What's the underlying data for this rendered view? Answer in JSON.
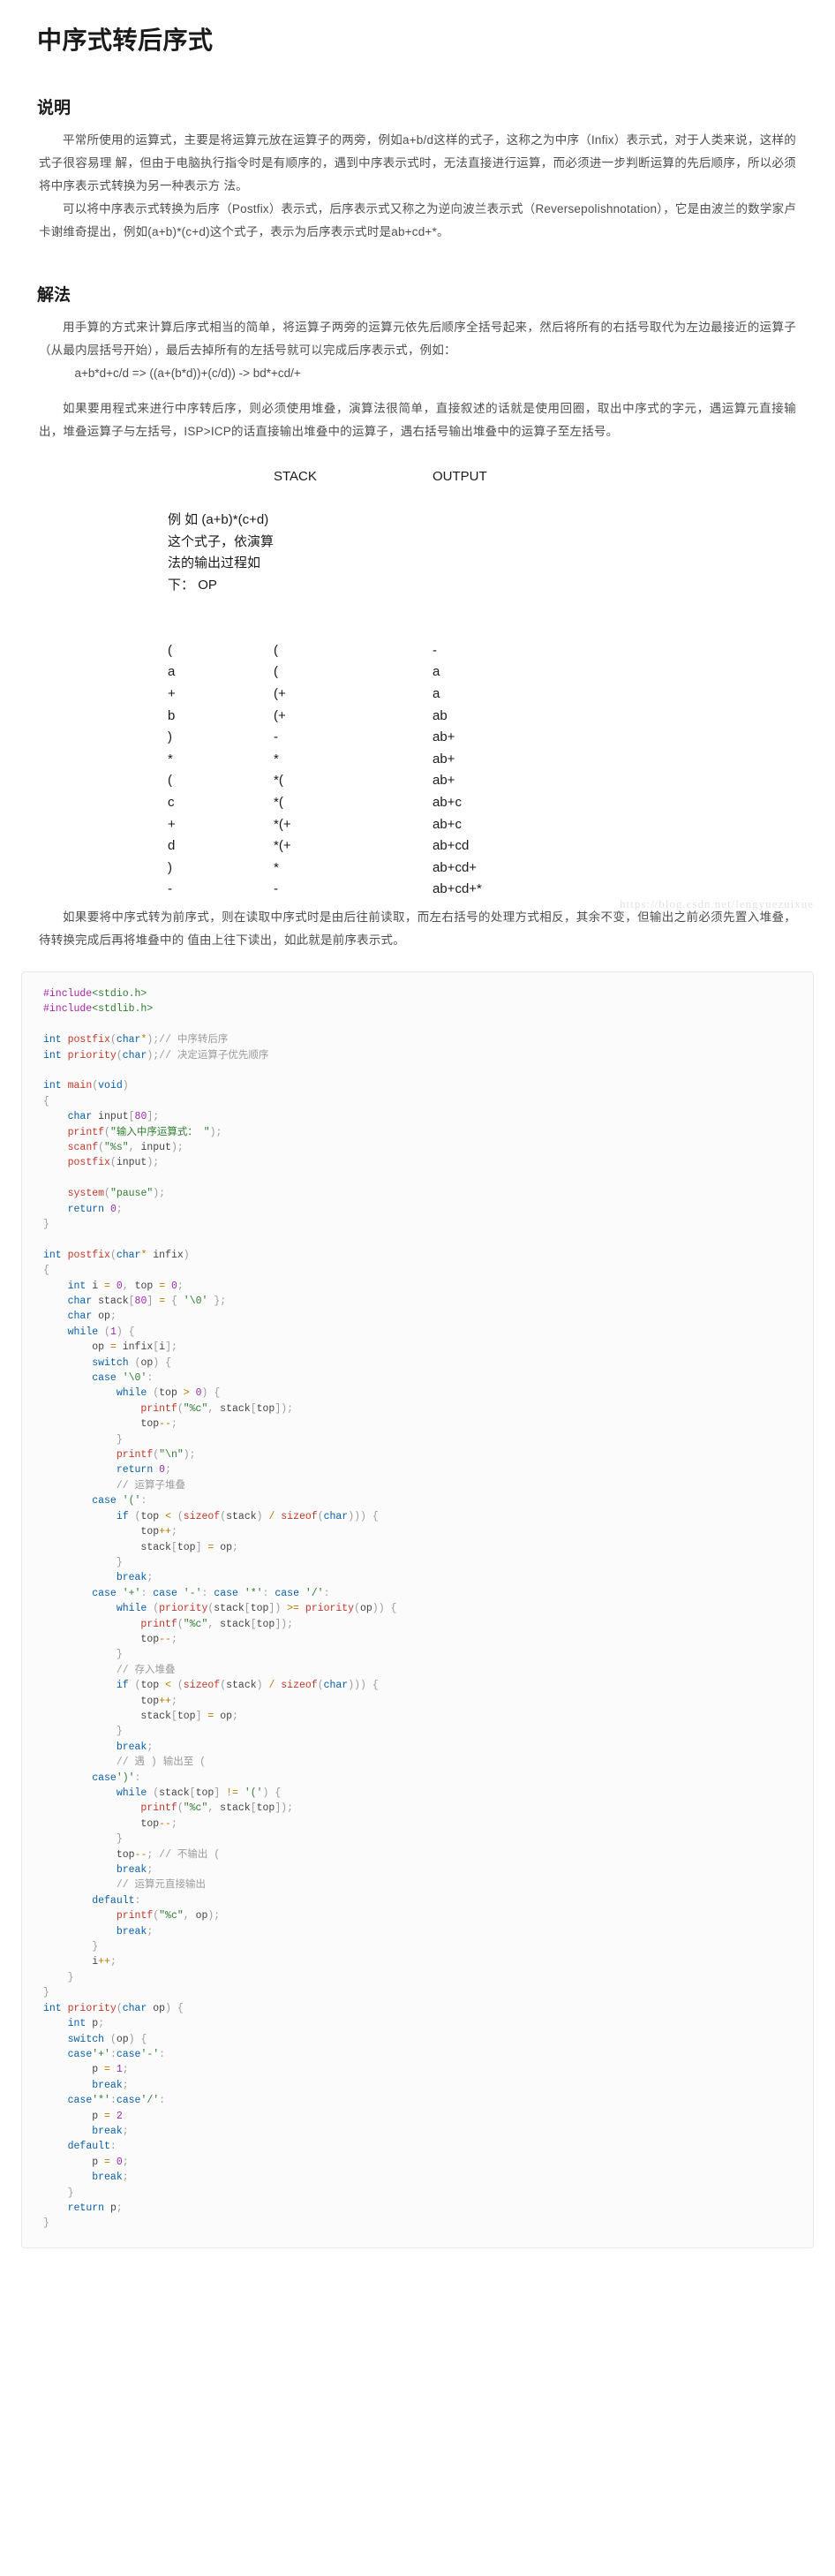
{
  "article": {
    "title": "中序式转后序式",
    "watermark": "https://blog.csdn.net/lengyuezuixue"
  },
  "sections": [
    {
      "heading": "说明"
    },
    {
      "heading": "解法"
    }
  ],
  "explain": {
    "heading": "说明",
    "p1": "平常所使用的运算式，主要是将运算元放在运算子的两旁，例如a+b/d这样的式子，这称之为中序（Infix）表示式，对于人类来说，这样的式子很容易理 解，但由于电脑执行指令时是有顺序的，遇到中序表示式时，无法直接进行运算，而必须进一步判断运算的先后顺序，所以必须将中序表示式转换为另一种表示方 法。",
    "p2": "可以将中序表示式转换为后序（Postfix）表示式，后序表示式又称之为逆向波兰表示式（Reversepolishnotation），它是由波兰的数学家卢卡谢维奇提出，例如(a+b)*(c+d)这个式子，表示为后序表示式时是ab+cd+*。"
  },
  "solution": {
    "heading": "解法",
    "p1": "用手算的方式来计算后序式相当的简单，将运算子两旁的运算元依先后顺序全括号起来，然后将所有的右括号取代为左边最接近的运算子（从最内层括号开始），最后去掉所有的左括号就可以完成后序表示式，例如：",
    "example": "a+b*d+c/d => ((a+(b*d))+(c/d)) -> bd*+cd/+",
    "p2": "如果要用程式来进行中序转后序，则必须使用堆叠，演算法很简单，直接叙述的话就是使用回圈，取出中序式的字元，遇运算元直接输出，堆叠运算子与左括号，ISP>ICP的话直接输出堆叠中的运算子，遇右括号输出堆叠中的运算子至左括号。",
    "p3": "如果要将中序式转为前序式，则在读取中序式时是由后往前读取，而左右括号的处理方式相反，其余不变，但输出之前必须先置入堆叠，待转换完成后再将堆叠中的 值由上往下读出，如此就是前序表示式。"
  },
  "trace": {
    "intro_expr": "例 如 (a+b)*(c+d)",
    "intro_rest": "这个式子，依演算法的输出过程如下：",
    "columns": [
      "OP",
      "STACK",
      "OUTPUT"
    ],
    "rows": [
      {
        "op": "(",
        "stack": "(",
        "output": "-"
      },
      {
        "op": "a",
        "stack": "(",
        "output": "a"
      },
      {
        "op": "+",
        "stack": "(+",
        "output": "a"
      },
      {
        "op": "b",
        "stack": "(+",
        "output": "ab"
      },
      {
        "op": ")",
        "stack": "-",
        "output": "ab+"
      },
      {
        "op": "*",
        "stack": "*",
        "output": "ab+"
      },
      {
        "op": "(",
        "stack": "*(",
        "output": "ab+"
      },
      {
        "op": "c",
        "stack": "*(",
        "output": "ab+c"
      },
      {
        "op": "+",
        "stack": "*(+",
        "output": "ab+c"
      },
      {
        "op": "d",
        "stack": "*(+",
        "output": "ab+cd"
      },
      {
        "op": ")",
        "stack": "*",
        "output": "ab+cd+"
      },
      {
        "op": "-",
        "stack": "-",
        "output": "ab+cd+*"
      }
    ]
  },
  "code": {
    "language": "c",
    "lines": [
      "#include<stdio.h>",
      "#include<stdlib.h>",
      "",
      "int postfix(char*);// 中序转后序",
      "int priority(char);// 决定运算子优先顺序",
      "",
      "int main(void)",
      "{",
      "    char input[80];",
      "    printf(\"输入中序运算式： \");",
      "    scanf(\"%s\", input);",
      "    postfix(input);",
      "",
      "    system(\"pause\");",
      "    return 0;",
      "}",
      "",
      "int postfix(char* infix)",
      "{",
      "    int i = 0, top = 0;",
      "    char stack[80] = { '\\0' };",
      "    char op;",
      "    while (1) {",
      "        op = infix[i];",
      "        switch (op) {",
      "        case '\\0':",
      "            while (top > 0) {",
      "                printf(\"%c\", stack[top]);",
      "                top--;",
      "            }",
      "            printf(\"\\n\");",
      "            return 0;",
      "            // 运算子堆叠",
      "        case '(':",
      "            if (top < (sizeof(stack) / sizeof(char))) {",
      "                top++;",
      "                stack[top] = op;",
      "            }",
      "            break;",
      "        case '+': case '-': case '*': case '/':",
      "            while (priority(stack[top]) >= priority(op)) {",
      "                printf(\"%c\", stack[top]);",
      "                top--;",
      "            }",
      "            // 存入堆叠",
      "            if (top < (sizeof(stack) / sizeof(char))) {",
      "                top++;",
      "                stack[top] = op;",
      "            }",
      "            break;",
      "            // 遇 ) 输出至 (",
      "        case')':",
      "            while (stack[top] != '(') {",
      "                printf(\"%c\", stack[top]);",
      "                top--;",
      "            }",
      "            top--; // 不输出 (",
      "            break;",
      "            // 运算元直接输出",
      "        default:",
      "            printf(\"%c\", op);",
      "            break;",
      "        }",
      "        i++;",
      "    }",
      "}",
      "int priority(char op) {",
      "    int p;",
      "    switch (op) {",
      "    case'+':case'-':",
      "        p = 1;",
      "        break;",
      "    case'*':case'/':",
      "        p = 2",
      "        break;",
      "    default:",
      "        p = 0;",
      "        break;",
      "    }",
      "    return p;",
      "}"
    ]
  },
  "colors": {
    "keyword": "#0b5fa5",
    "function": "#c0392b",
    "string": "#2f7d32",
    "number": "#9c27b0",
    "comment": "#9b9b9b",
    "preprocessor": "#a626a4",
    "operator": "#bc7a00",
    "code_bg": "#fbfbfb",
    "text": "#4f4f4f",
    "heading": "#1a1a1a"
  }
}
